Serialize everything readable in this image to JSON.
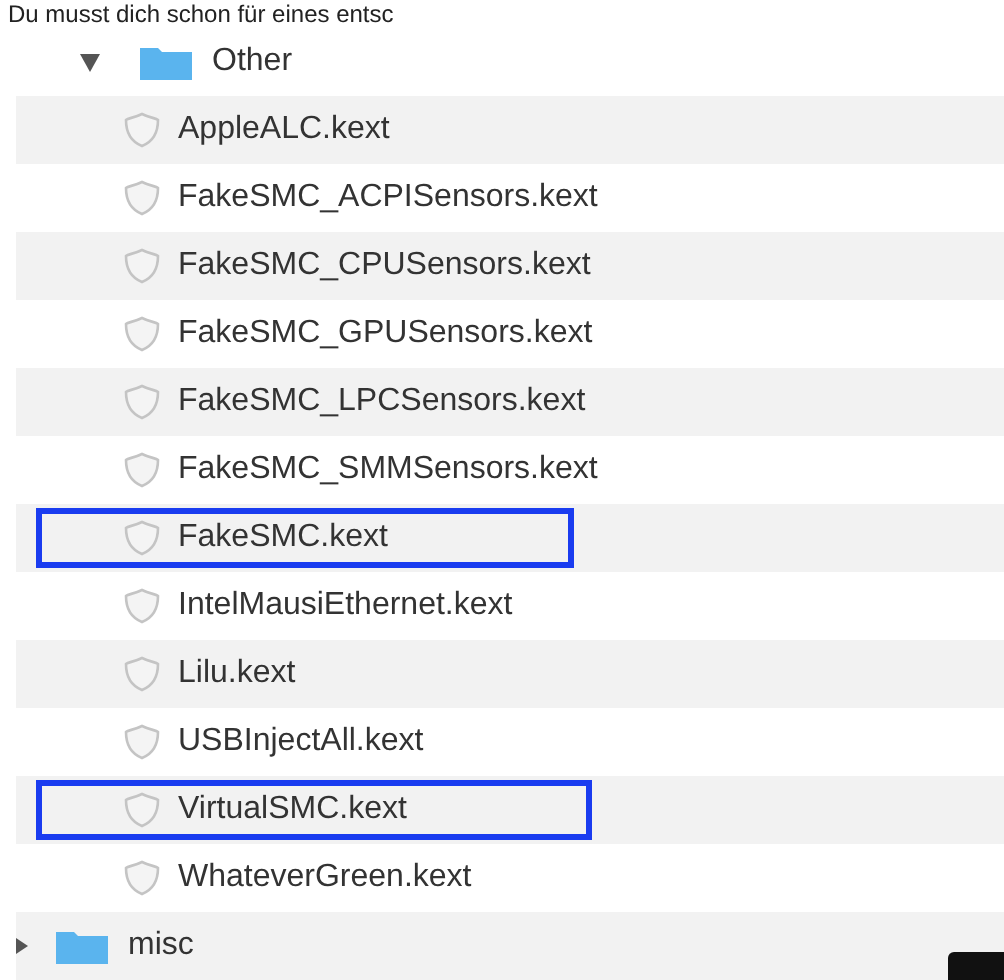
{
  "caption": "Du musst dich schon für eines entsc",
  "tree": [
    {
      "name": "Other",
      "kind": "folder",
      "expanded": true,
      "children": [
        {
          "name": "AppleALC.kext",
          "kind": "kext",
          "highlighted": false
        },
        {
          "name": "FakeSMC_ACPISensors.kext",
          "kind": "kext",
          "highlighted": false
        },
        {
          "name": "FakeSMC_CPUSensors.kext",
          "kind": "kext",
          "highlighted": false
        },
        {
          "name": "FakeSMC_GPUSensors.kext",
          "kind": "kext",
          "highlighted": false
        },
        {
          "name": "FakeSMC_LPCSensors.kext",
          "kind": "kext",
          "highlighted": false
        },
        {
          "name": "FakeSMC_SMMSensors.kext",
          "kind": "kext",
          "highlighted": false
        },
        {
          "name": "FakeSMC.kext",
          "kind": "kext",
          "highlighted": true
        },
        {
          "name": "IntelMausiEthernet.kext",
          "kind": "kext",
          "highlighted": false
        },
        {
          "name": "Lilu.kext",
          "kind": "kext",
          "highlighted": false
        },
        {
          "name": "USBInjectAll.kext",
          "kind": "kext",
          "highlighted": false
        },
        {
          "name": "VirtualSMC.kext",
          "kind": "kext",
          "highlighted": true
        },
        {
          "name": "WhateverGreen.kext",
          "kind": "kext",
          "highlighted": false
        }
      ]
    }
  ],
  "outer_items": [
    {
      "name": "misc",
      "kind": "folder",
      "expanded": false
    }
  ]
}
